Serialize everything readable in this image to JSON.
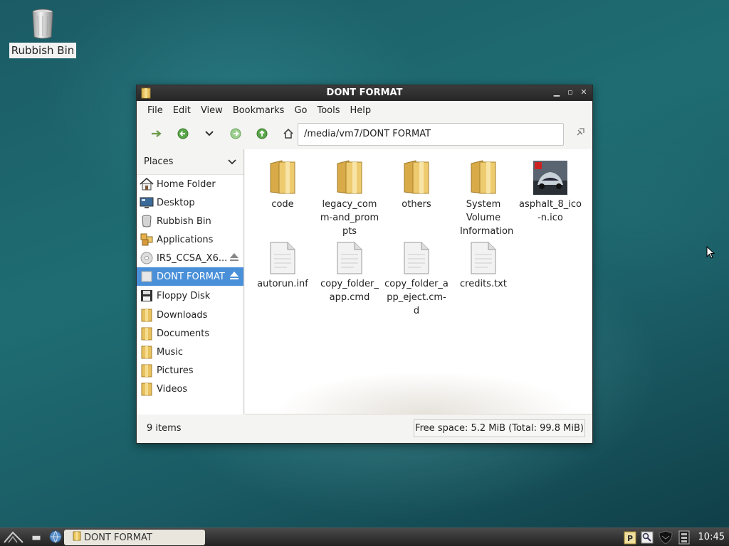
{
  "desktop": {
    "icons": [
      {
        "label": "Rubbish Bin",
        "icon": "trash-icon"
      }
    ]
  },
  "window": {
    "title": "DONT FORMAT",
    "menu": [
      "File",
      "Edit",
      "View",
      "Bookmarks",
      "Go",
      "Tools",
      "Help"
    ],
    "path": "/media/vm7/DONT FORMAT",
    "sidebar": {
      "header": "Places",
      "items": [
        {
          "label": "Home Folder",
          "icon": "home-icon"
        },
        {
          "label": "Desktop",
          "icon": "desktop-icon"
        },
        {
          "label": "Rubbish Bin",
          "icon": "trash-icon"
        },
        {
          "label": "Applications",
          "icon": "applications-icon"
        },
        {
          "label": "IR5_CCSA_X6...",
          "icon": "disc-icon"
        },
        {
          "label": "DONT FORMAT",
          "icon": "drive-icon",
          "selected": true
        },
        {
          "label": "Floppy Disk",
          "icon": "floppy-icon"
        },
        {
          "label": "Downloads",
          "icon": "folder-icon"
        },
        {
          "label": "Documents",
          "icon": "folder-icon"
        },
        {
          "label": "Music",
          "icon": "folder-icon"
        },
        {
          "label": "Pictures",
          "icon": "folder-icon"
        },
        {
          "label": "Videos",
          "icon": "folder-icon"
        }
      ]
    },
    "files": [
      {
        "name": "code",
        "type": "folder"
      },
      {
        "name": "legacy_comm-and_prompts",
        "type": "folder"
      },
      {
        "name": "others",
        "type": "folder"
      },
      {
        "name": "System Volume Information",
        "type": "folder"
      },
      {
        "name": "asphalt_8_ico-n.ico",
        "type": "image"
      },
      {
        "name": "autorun.inf",
        "type": "document"
      },
      {
        "name": "copy_folder_app.cmd",
        "type": "document"
      },
      {
        "name": "copy_folder_app_eject.cm-d",
        "type": "document"
      },
      {
        "name": "credits.txt",
        "type": "document"
      }
    ],
    "status": {
      "items": "9 items",
      "free_space": "Free space: 5.2 MiB (Total: 99.8 MiB)"
    }
  },
  "taskbar": {
    "task_label": "DONT FORMAT",
    "clock": "10:45"
  },
  "colors": {
    "selection": "#4a90d9",
    "titlebar": "#2e2e2e",
    "folder": "#e8c25e"
  }
}
